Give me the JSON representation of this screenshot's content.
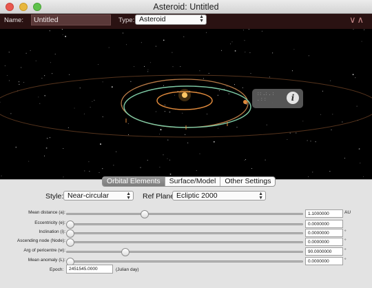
{
  "window": {
    "title": "Asteroid: Untitled"
  },
  "header": {
    "name_label": "Name:",
    "name_value": "Untitled",
    "type_label": "Type:",
    "type_value": "Asteroid",
    "collapse_glyphs": "∨∧"
  },
  "scene": {
    "info_icon": "i",
    "info_glyphs": ": :  . :  .  :\n.  :  :"
  },
  "tabs": [
    {
      "label": "Orbital Elements",
      "active": true
    },
    {
      "label": "Surface/Model",
      "active": false
    },
    {
      "label": "Other Settings",
      "active": false
    }
  ],
  "orbit": {
    "style_label": "Style:",
    "style_value": "Near-circular",
    "refplane_label": "Ref Plane:",
    "refplane_value": "Ecliptic 2000",
    "rows": [
      {
        "label": "Mean distance (a):",
        "value": "1.1000000",
        "unit": "AU",
        "slider": 0.33
      },
      {
        "label": "Eccentricity (e):",
        "value": "0.0000000",
        "unit": "",
        "slider": 0.0
      },
      {
        "label": "Inclination (i):",
        "value": "0.0000000",
        "unit": "°",
        "slider": 0.0
      },
      {
        "label": "Ascending node (Node):",
        "value": "0.0000000",
        "unit": "°",
        "slider": 0.0
      },
      {
        "label": "Arg of pericentre (w):",
        "value": "90.0000000",
        "unit": "°",
        "slider": 0.25
      },
      {
        "label": "Mean anomaly (L):",
        "value": "0.0000000",
        "unit": "°",
        "slider": 0.0
      }
    ],
    "epoch_label": "Epoch:",
    "epoch_value": "2451545.0000",
    "epoch_unit": "(Julian day)"
  },
  "colors": {
    "header_bg": "#2a1212",
    "orbit_orange": "#e08a3c",
    "orbit_green": "#7dc9a4",
    "sun": "#ffcf70"
  }
}
